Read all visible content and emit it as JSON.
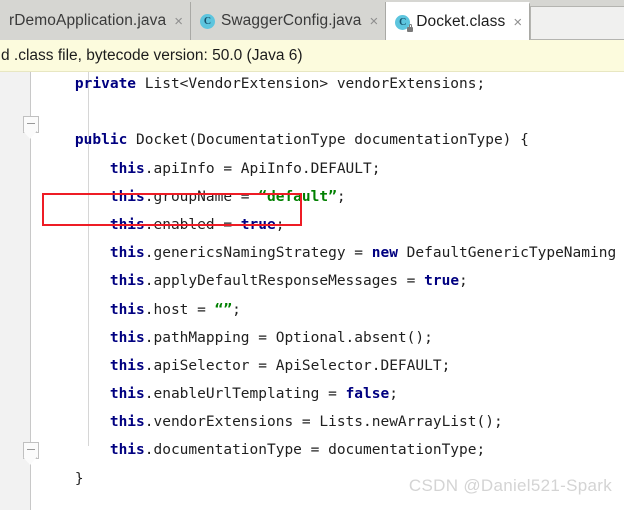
{
  "window": {
    "app": "IntelliJ IDEA Editor"
  },
  "tabs": [
    {
      "label": "rDemoApplication.java",
      "icon": "java-file-icon",
      "icon_letter": "",
      "close_glyph": "×",
      "active": false,
      "has_icon": false,
      "locked": false
    },
    {
      "label": "SwaggerConfig.java",
      "icon": "java-class-icon",
      "icon_letter": "C",
      "close_glyph": "×",
      "active": false,
      "has_icon": true,
      "locked": false
    },
    {
      "label": "Docket.class",
      "icon": "compiled-class-icon",
      "icon_letter": "C",
      "close_glyph": "×",
      "active": true,
      "has_icon": true,
      "locked": true
    }
  ],
  "notification": {
    "text": "d .class file, bytecode version: 50.0 (Java 6)",
    "background": "#fcfbdd"
  },
  "editor": {
    "highlight": {
      "name": "red-annotation-box",
      "color": "#ee1c25",
      "targets_line": "this.enabled = true;"
    },
    "fold_markers": 2,
    "lines": [
      {
        "indent": 4,
        "tokens": [
          {
            "t": "private ",
            "c": "kw"
          },
          {
            "t": "List<VendorExtension> vendorExtensions;",
            "c": "pl"
          }
        ]
      },
      {
        "indent": 0,
        "tokens": [
          {
            "t": "",
            "c": "pl"
          }
        ]
      },
      {
        "indent": 4,
        "tokens": [
          {
            "t": "public ",
            "c": "kw"
          },
          {
            "t": "Docket(DocumentationType documentationType) {",
            "c": "pl"
          }
        ]
      },
      {
        "indent": 8,
        "tokens": [
          {
            "t": "this",
            "c": "kw"
          },
          {
            "t": ".apiInfo = ApiInfo.DEFAULT;",
            "c": "pl"
          }
        ]
      },
      {
        "indent": 8,
        "tokens": [
          {
            "t": "this",
            "c": "kw"
          },
          {
            "t": ".groupName = ",
            "c": "pl"
          },
          {
            "t": "“default”",
            "c": "str"
          },
          {
            "t": ";",
            "c": "pl"
          }
        ]
      },
      {
        "indent": 8,
        "tokens": [
          {
            "t": "this",
            "c": "kw"
          },
          {
            "t": ".enabled = ",
            "c": "pl"
          },
          {
            "t": "true",
            "c": "kw"
          },
          {
            "t": ";",
            "c": "pl"
          }
        ]
      },
      {
        "indent": 8,
        "tokens": [
          {
            "t": "this",
            "c": "kw"
          },
          {
            "t": ".genericsNamingStrategy = ",
            "c": "pl"
          },
          {
            "t": "new ",
            "c": "kw"
          },
          {
            "t": "DefaultGenericTypeNaming",
            "c": "pl"
          }
        ]
      },
      {
        "indent": 8,
        "tokens": [
          {
            "t": "this",
            "c": "kw"
          },
          {
            "t": ".applyDefaultResponseMessages = ",
            "c": "pl"
          },
          {
            "t": "true",
            "c": "kw"
          },
          {
            "t": ";",
            "c": "pl"
          }
        ]
      },
      {
        "indent": 8,
        "tokens": [
          {
            "t": "this",
            "c": "kw"
          },
          {
            "t": ".host = ",
            "c": "pl"
          },
          {
            "t": "“”",
            "c": "str"
          },
          {
            "t": ";",
            "c": "pl"
          }
        ]
      },
      {
        "indent": 8,
        "tokens": [
          {
            "t": "this",
            "c": "kw"
          },
          {
            "t": ".pathMapping = Optional.absent();",
            "c": "pl"
          }
        ]
      },
      {
        "indent": 8,
        "tokens": [
          {
            "t": "this",
            "c": "kw"
          },
          {
            "t": ".apiSelector = ApiSelector.DEFAULT;",
            "c": "pl"
          }
        ]
      },
      {
        "indent": 8,
        "tokens": [
          {
            "t": "this",
            "c": "kw"
          },
          {
            "t": ".enableUrlTemplating = ",
            "c": "pl"
          },
          {
            "t": "false",
            "c": "kw"
          },
          {
            "t": ";",
            "c": "pl"
          }
        ]
      },
      {
        "indent": 8,
        "tokens": [
          {
            "t": "this",
            "c": "kw"
          },
          {
            "t": ".vendorExtensions = Lists.newArrayList();",
            "c": "pl"
          }
        ]
      },
      {
        "indent": 8,
        "tokens": [
          {
            "t": "this",
            "c": "kw"
          },
          {
            "t": ".documentationType = documentationType;",
            "c": "pl"
          }
        ]
      },
      {
        "indent": 4,
        "tokens": [
          {
            "t": "}",
            "c": "pl"
          }
        ]
      }
    ]
  },
  "watermark": {
    "text": "CSDN @Daniel521-Spark"
  }
}
